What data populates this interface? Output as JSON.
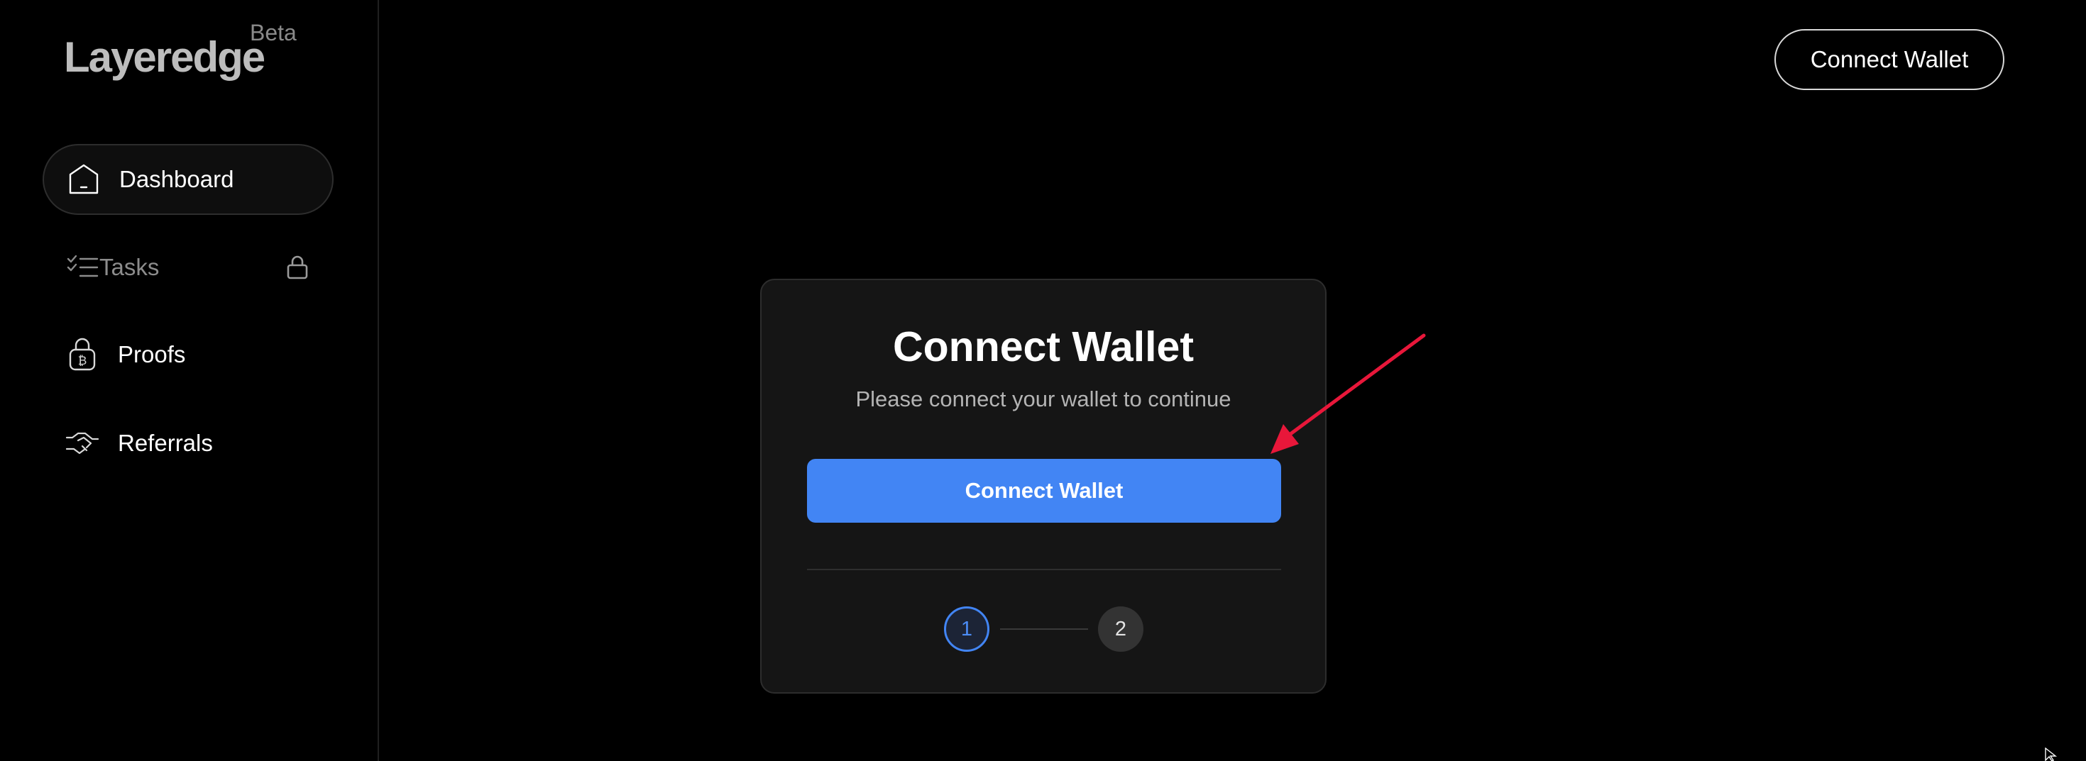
{
  "app": {
    "logo_text": "Layeredge",
    "logo_badge": "Beta"
  },
  "sidebar": {
    "items": [
      {
        "label": "Dashboard",
        "icon": "home-icon",
        "active": true
      },
      {
        "label": "Tasks",
        "icon": "checklist-icon",
        "locked": true
      },
      {
        "label": "Proofs",
        "icon": "bitcoin-lock-icon"
      },
      {
        "label": "Referrals",
        "icon": "handshake-icon"
      }
    ]
  },
  "header": {
    "connect_label": "Connect Wallet"
  },
  "modal": {
    "title": "Connect Wallet",
    "subtitle": "Please connect your wallet to continue",
    "button_label": "Connect Wallet",
    "steps": [
      "1",
      "2"
    ],
    "current_step": 1
  },
  "colors": {
    "accent": "#4285f4",
    "annotation_arrow": "#e8173a",
    "background": "#000000",
    "card": "#151515"
  }
}
